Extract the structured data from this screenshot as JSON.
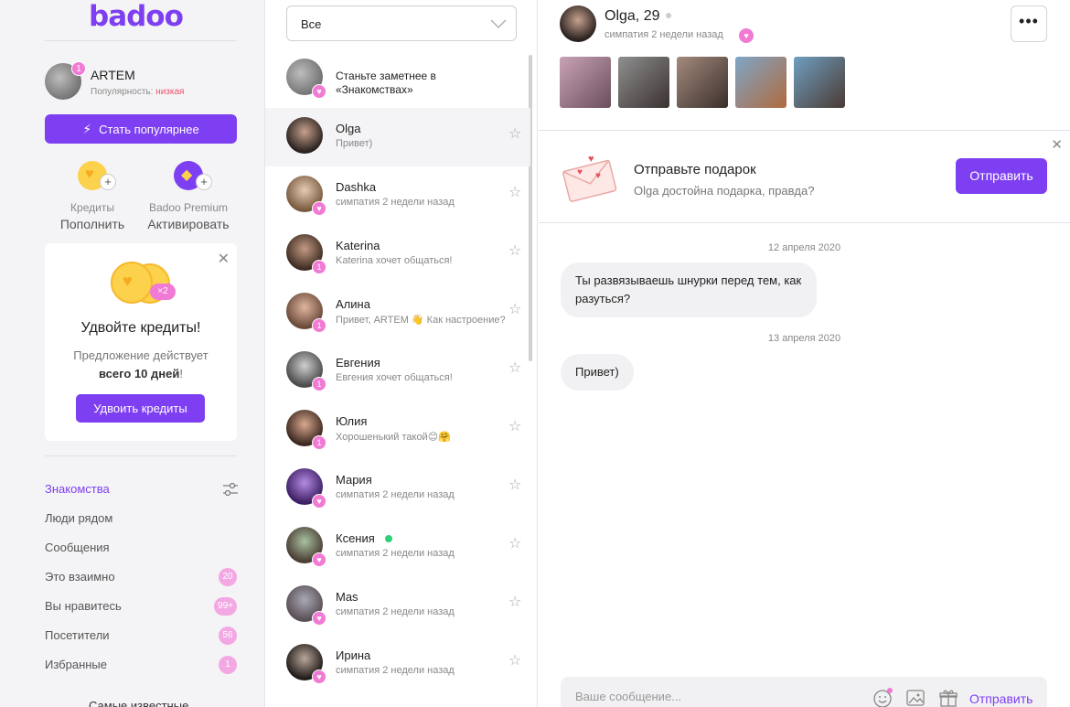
{
  "sidebar": {
    "logo": "badoo",
    "profile": {
      "name": "ARTEM",
      "badge": "1",
      "popularity_label": "Популярность:",
      "popularity_value": "низкая"
    },
    "boost_button": "Стать популярнее",
    "features": [
      {
        "label": "Кредиты",
        "action": "Пополнить",
        "icon": "heart-coin-icon"
      },
      {
        "label": "Badoo Premium",
        "action": "Активировать",
        "icon": "diamond-icon"
      }
    ],
    "promo": {
      "badge": "×2",
      "title": "Удвойте кредиты!",
      "text_prefix": "Предложение действует",
      "text_bold": "всего 10 дней",
      "text_suffix": "!",
      "button": "Удвоить кредиты"
    },
    "nav": [
      {
        "label": "Знакомства",
        "count": ""
      },
      {
        "label": "Люди рядом",
        "count": ""
      },
      {
        "label": "Сообщения",
        "count": ""
      },
      {
        "label": "Это взаимно",
        "count": "20"
      },
      {
        "label": "Вы нравитесь",
        "count": "99+"
      },
      {
        "label": "Посетители",
        "count": "56"
      },
      {
        "label": "Избранные",
        "count": "1"
      }
    ],
    "more": "Самые известные"
  },
  "list": {
    "filter_value": "Все",
    "items": [
      {
        "name": "Станьте заметнее в «Знакомствах»",
        "sub": "",
        "badge": "heart"
      },
      {
        "name": "Olga",
        "sub": "Привет)",
        "badge": ""
      },
      {
        "name": "Dashka",
        "sub": "симпатия 2 недели назад",
        "badge": "heart"
      },
      {
        "name": "Katerina",
        "sub": "Katerina хочет общаться!",
        "badge": "1"
      },
      {
        "name": "Алина",
        "sub": "Привет, ARTEM 👋 Как настроение?",
        "badge": "1"
      },
      {
        "name": "Евгения",
        "sub": "Евгения хочет общаться!",
        "badge": "1"
      },
      {
        "name": "Юлия",
        "sub": "Хорошенький такой😊🤗",
        "badge": "1"
      },
      {
        "name": "Мария",
        "sub": "симпатия 2 недели назад",
        "badge": "heart"
      },
      {
        "name": "Ксения",
        "sub": "симпатия 2 недели назад",
        "badge": "heart"
      },
      {
        "name": "Mas",
        "sub": "симпатия 2 недели назад",
        "badge": "heart"
      },
      {
        "name": "Ирина",
        "sub": "симпатия 2 недели назад",
        "badge": "heart"
      }
    ]
  },
  "chat": {
    "peer_name": "Olga, 29",
    "peer_sub": "симпатия 2 недели назад",
    "gift": {
      "title": "Отправьте подарок",
      "subtitle": "Olga достойна подарка, правда?",
      "button": "Отправить"
    },
    "messages": [
      {
        "date": "12 апреля 2020",
        "text": "Ты развязываешь шнурки перед тем, как разуться?"
      },
      {
        "date": "13 апреля 2020",
        "text": "Привет)"
      }
    ],
    "composer": {
      "placeholder": "Ваше сообщение...",
      "send": "Отправить"
    }
  },
  "colors": {
    "accent": "#7e3ff2",
    "badge_pink": "#f17ad4",
    "low_popularity": "#f0506e",
    "online": "#2fcf7a"
  }
}
